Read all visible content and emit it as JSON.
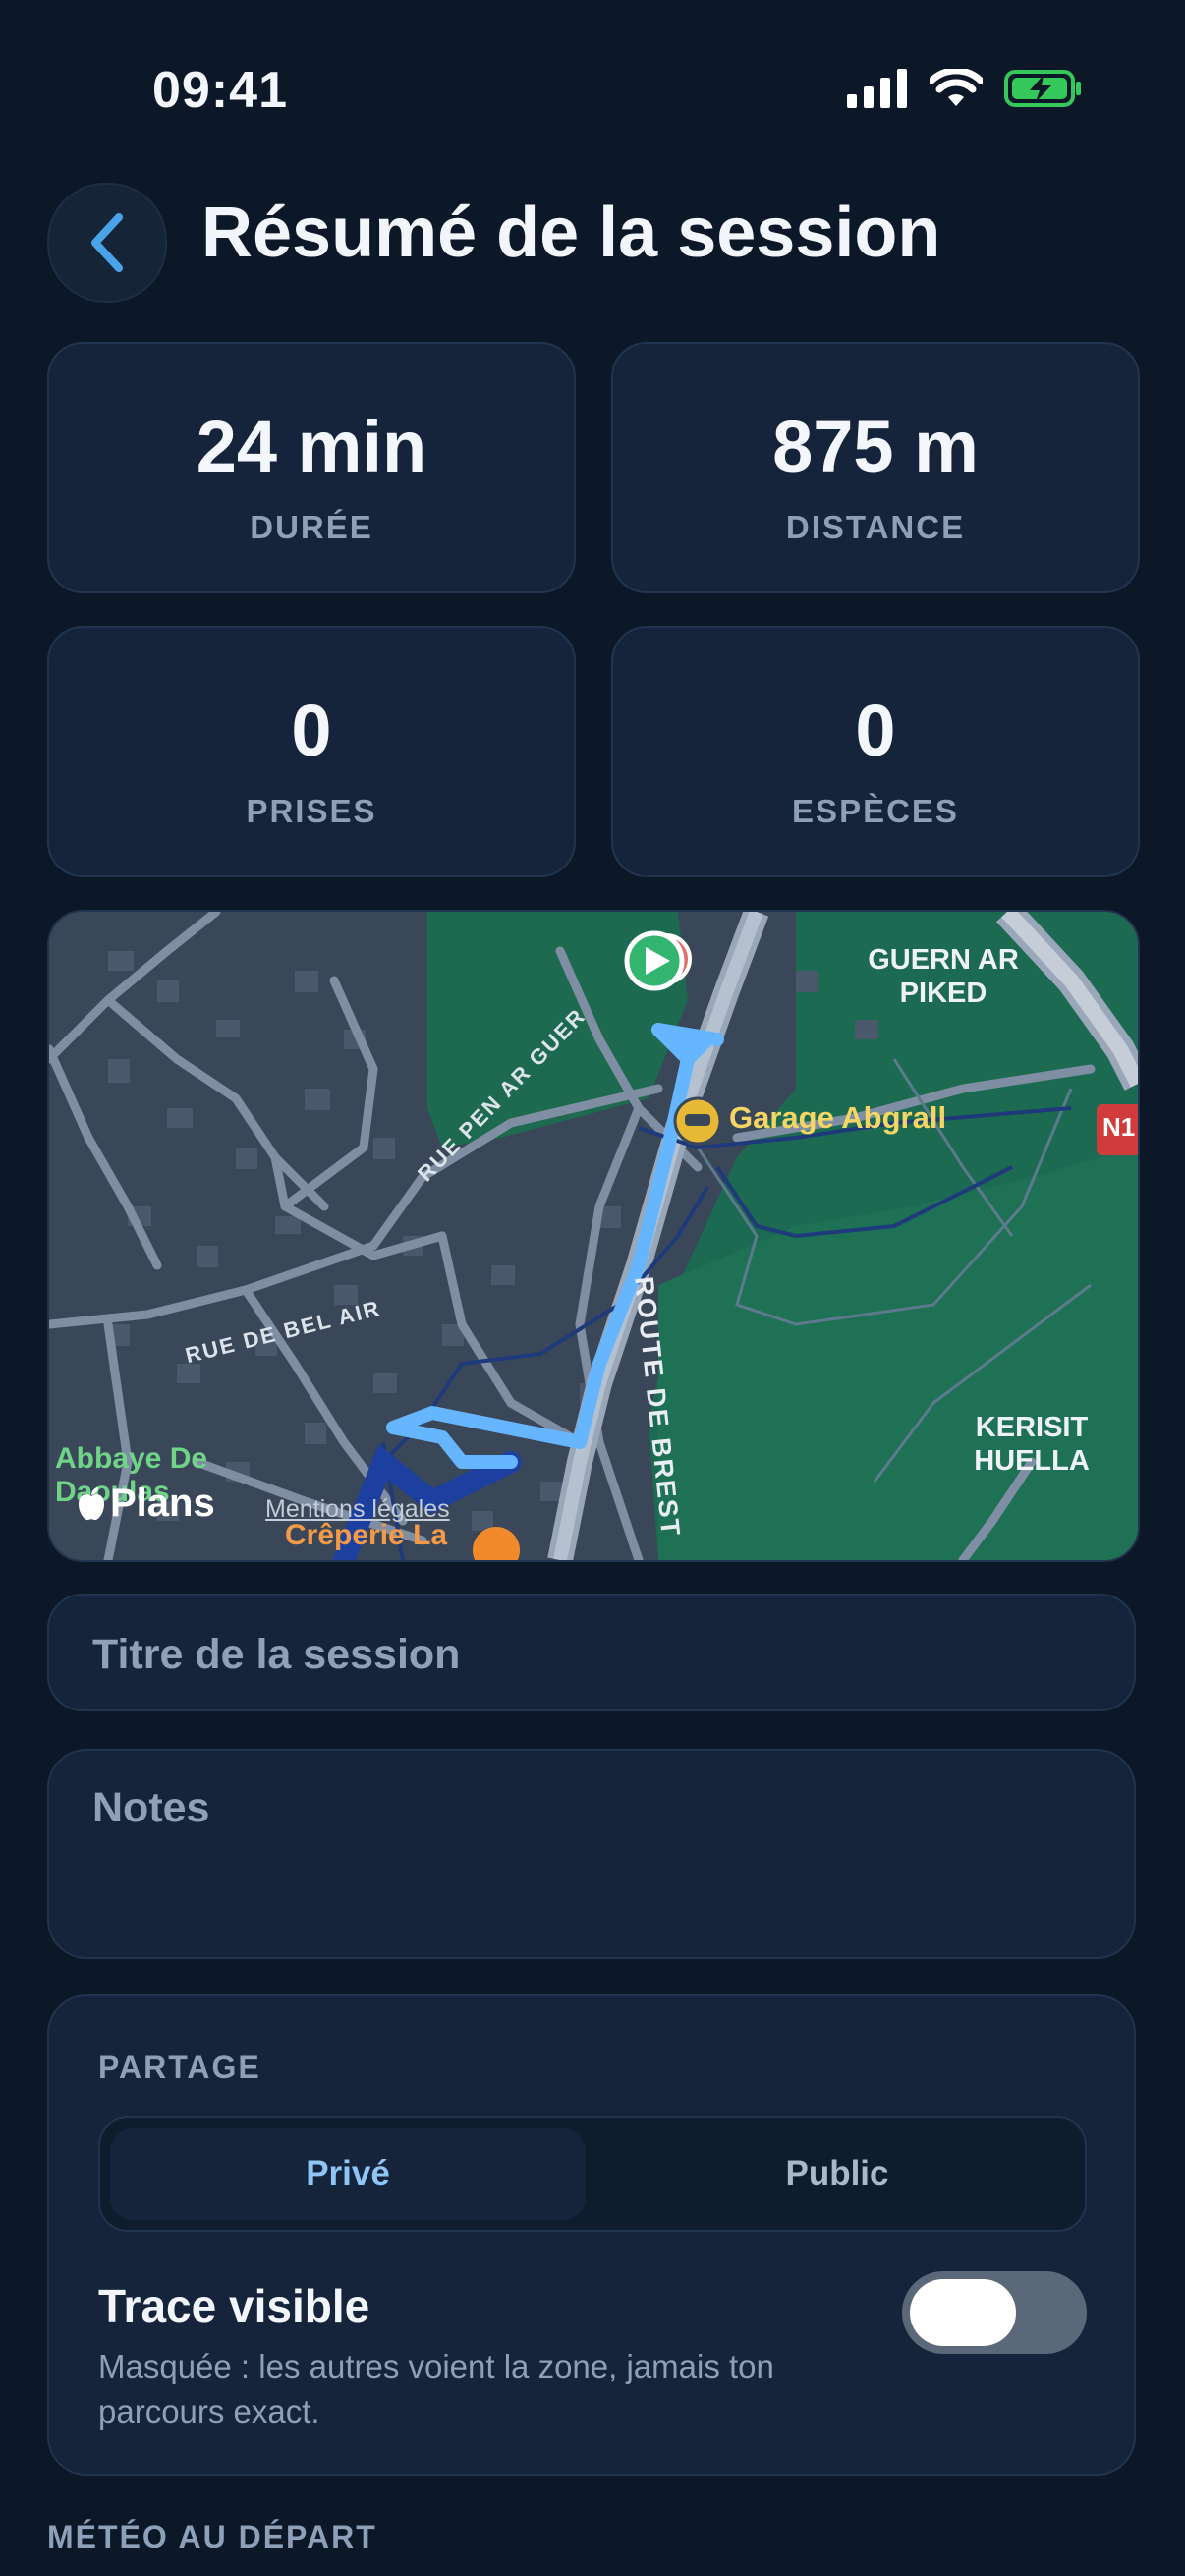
{
  "status_bar": {
    "time": "09:41",
    "icons": [
      "signal-icon",
      "wifi-icon",
      "battery-charging-icon"
    ]
  },
  "header": {
    "back_icon": "chevron-left-icon",
    "title": "Résumé de la session"
  },
  "stats": [
    {
      "value": "24 min",
      "label": "DURÉE"
    },
    {
      "value": "875 m",
      "label": "DISTANCE"
    },
    {
      "value": "0",
      "label": "PRISES"
    },
    {
      "value": "0",
      "label": "ESPÈCES"
    }
  ],
  "map": {
    "labels": {
      "guern": "GUERN AR",
      "piked": "PIKED",
      "garage": "Garage Abgrall",
      "road_n": "N1",
      "rue_pen": "RUE PEN AR GUER",
      "route_brest": "ROUTE DE BREST",
      "rue_bel_air": "RUE DE BEL AIR",
      "kerisit": "KERISIT",
      "huella": "HUELLA",
      "abbaye1": "Abbaye De",
      "abbaye2": "Daoulas",
      "creperie": "Crêperie La",
      "legal": "Mentions légales",
      "attribution": "Plans"
    },
    "colors": {
      "route": "#66b6ff",
      "land": "#3a4759",
      "forest": "#1e6b52"
    }
  },
  "form": {
    "title_placeholder": "Titre de la session",
    "notes_placeholder": "Notes"
  },
  "sharing": {
    "section_label": "PARTAGE",
    "options": [
      "Privé",
      "Public"
    ],
    "selected": "Privé",
    "trace_title": "Trace visible",
    "trace_description_1": "Masquée : les autres voient la zone, jamais ton",
    "trace_description_2": "parcours exact.",
    "trace_enabled": false
  },
  "weather": {
    "section_label": "MÉTÉO AU DÉPART"
  },
  "colors": {
    "background": "#0c1728",
    "card": "#15243a",
    "accent": "#4aa3e8"
  }
}
